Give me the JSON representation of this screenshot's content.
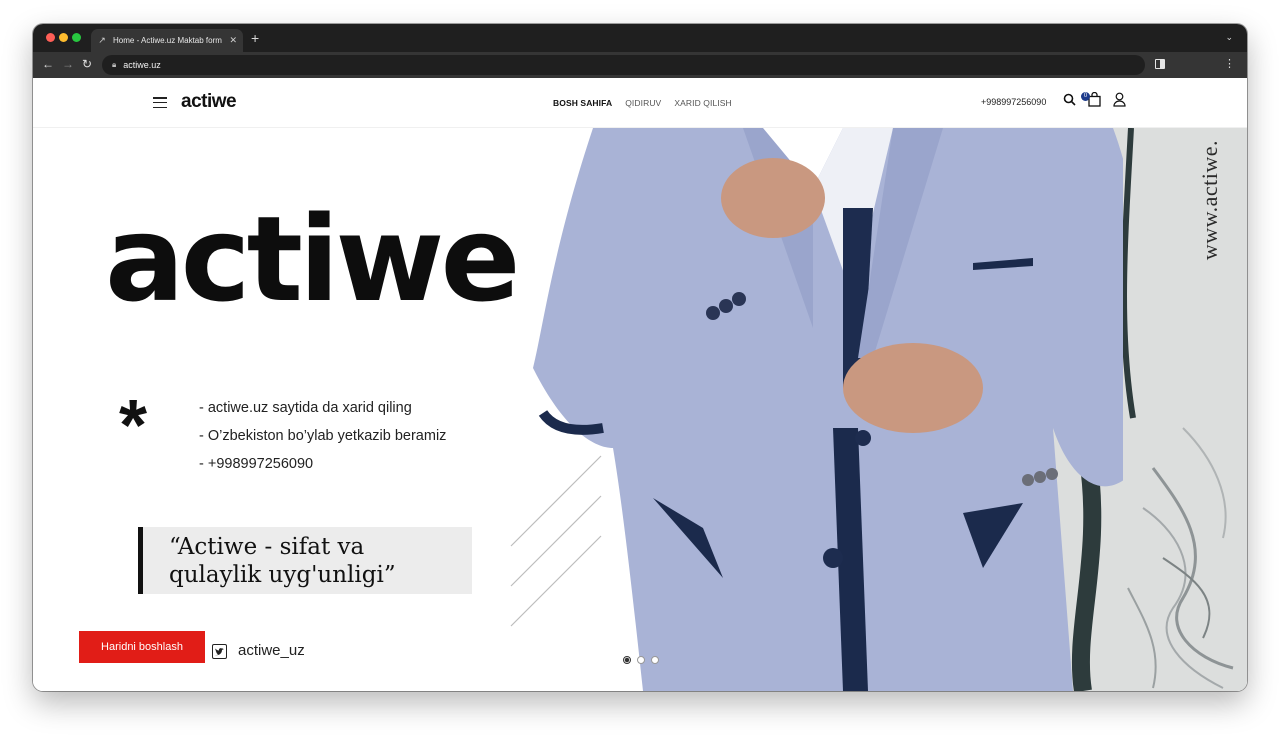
{
  "browser": {
    "tab_title": "Home - Actiwe.uz Maktab form",
    "tab_favicon": "actiwe-favicon-icon",
    "url": "actiwe.uz",
    "colors": {
      "close": "#ff5f57",
      "minimize": "#febc2e",
      "zoom": "#28c840"
    }
  },
  "header": {
    "logo": "actiwe",
    "nav": [
      {
        "label": "BOSH SAHIFA",
        "active": true
      },
      {
        "label": "QIDIRUV",
        "active": false
      },
      {
        "label": "XARID QILISH",
        "active": false
      }
    ],
    "phone": "+998997256090",
    "cart_count": "0",
    "accent": "#1c3a8a"
  },
  "hero": {
    "big_logo": "actiwe",
    "asterisk": "*",
    "features": [
      "- actiwe.uz saytida da xarid qiling",
      "- O’zbekiston bo’ylab yetkazib beramiz",
      "- +998997256090"
    ],
    "quote_line1": "“Actiwe - sifat va",
    "quote_line2": "qulaylik uyg'unligi”",
    "cta_label": "Haridni boshlash",
    "cta_color": "#e11d17",
    "social_handle": "actiwe_uz",
    "watermark": "www.actiwe.",
    "slides_total": 3,
    "slide_active": 1
  }
}
